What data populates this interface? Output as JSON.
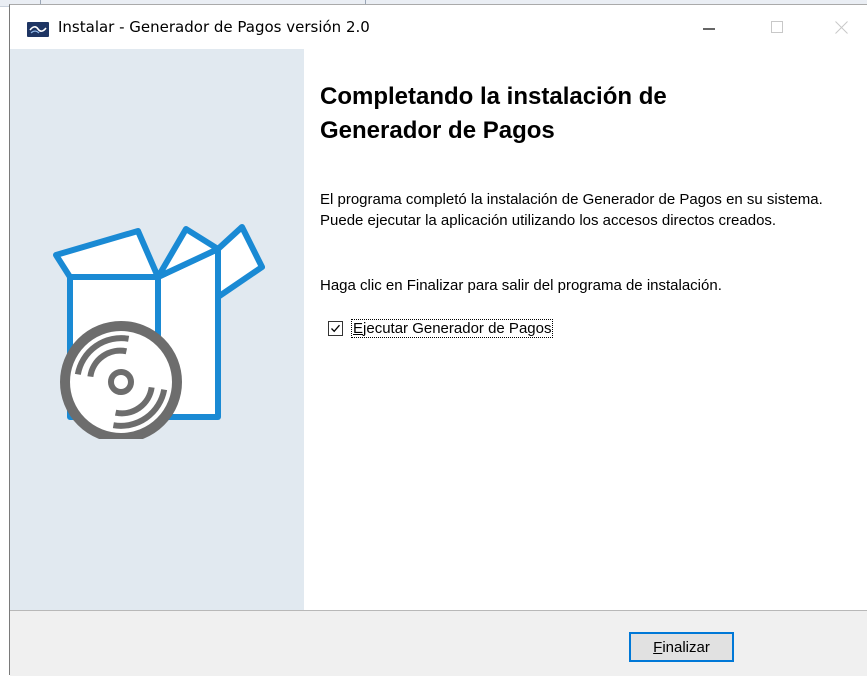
{
  "window": {
    "title": "Instalar - Generador de Pagos versión 2.0",
    "icon": "app-logo-icon",
    "controls": [
      "minimize-icon",
      "maximize-icon",
      "close-icon"
    ]
  },
  "content": {
    "heading_line1": "Completando la instalación de",
    "heading_line2": "Generador de Pagos",
    "paragraph1": "El programa completó la instalación de Generador de Pagos en su sistema. Puede ejecutar la aplicación utilizando los accesos directos creados.",
    "paragraph2": "Haga clic en Finalizar para salir del programa de instalación.",
    "run_checkbox": {
      "checked": true,
      "label_mnemonic": "E",
      "label_rest": "jecutar Generador de Pagos"
    }
  },
  "footer": {
    "finish_mnemonic": "F",
    "finish_rest": "inalizar"
  },
  "sidebar": {
    "illustration": "box-with-disc-icon"
  },
  "colors": {
    "accent": "#0078d7",
    "sidebar_bg": "#e1e9f0",
    "box_blue": "#1a8ad4",
    "disc_gray": "#6d6d6d"
  }
}
